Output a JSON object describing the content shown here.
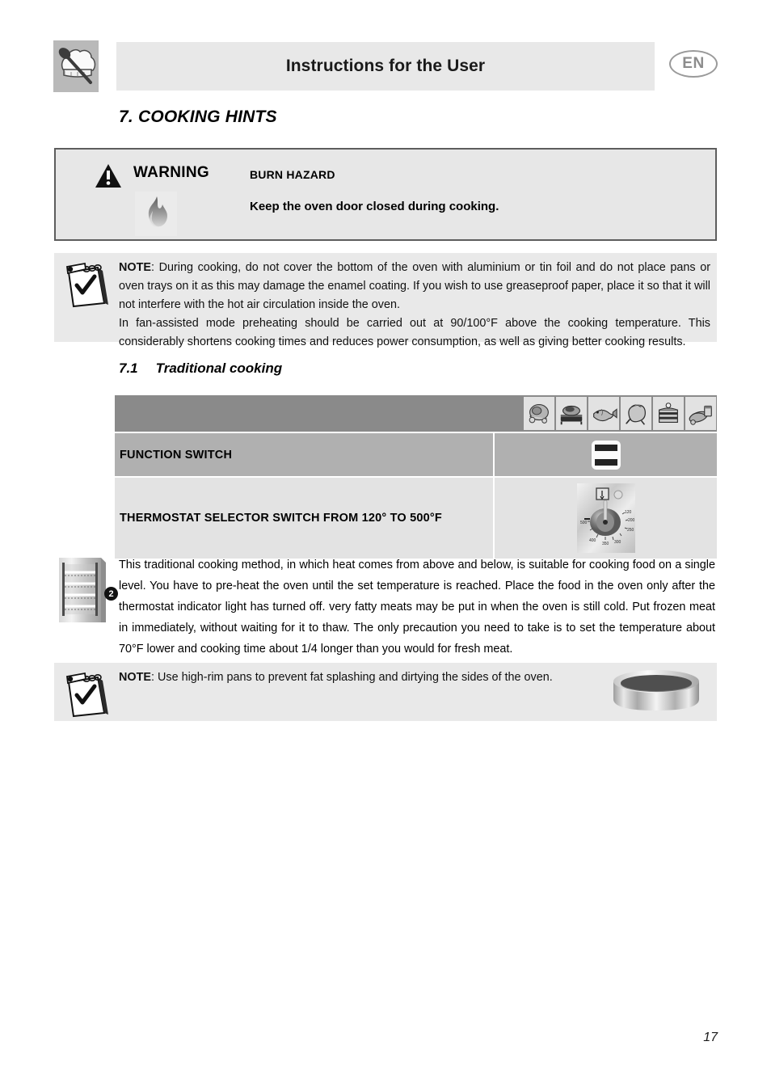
{
  "header": {
    "title": "Instructions for the User",
    "language_badge": "EN",
    "icon": "chef-hat-spoon-icon"
  },
  "section": {
    "number": "7.",
    "title": "7. COOKING HINTS"
  },
  "warning": {
    "label": "WARNING",
    "hazard_heading": "BURN HAZARD",
    "message": "Keep the oven door closed during cooking.",
    "triangle_icon": "warning-triangle-icon",
    "flame_icon": "flame-icon"
  },
  "note_general": {
    "label": "NOTE",
    "paragraph1": ": During cooking, do not cover the bottom of the oven with aluminium or tin foil and do not place pans or oven trays on it as this may damage the enamel coating. If you wish to use greaseproof paper, place it so that it will not interfere with the hot air circulation inside the oven.",
    "paragraph2": "In fan-assisted mode preheating should be carried out at 90/100°F above the cooking temperature. This considerably shortens cooking times and reduces power consumption, as well as giving better cooking results.",
    "icon": "notepad-checkmark-icon"
  },
  "subsection": {
    "number": "7.1",
    "title": "Traditional cooking"
  },
  "table": {
    "food_icons": [
      "roast-meat-icon",
      "grilled-meat-icon",
      "fish-icon",
      "poultry-icon",
      "cake-slice-icon",
      "pastry-bread-icon"
    ],
    "rows": [
      {
        "label": "FUNCTION SWITCH",
        "symbol": "top-bottom-heat-icon"
      },
      {
        "label": "THERMOSTAT SELECTOR SWITCH FROM 120° TO 500°F",
        "symbol": "thermostat-dial-icon"
      }
    ],
    "thermostat_dial_marks": [
      "120",
      "200",
      "250",
      "300",
      "350",
      "400",
      "500"
    ]
  },
  "description": {
    "shelf_level": "2",
    "oven_icon": "oven-shelf-levels-icon",
    "text": "This traditional cooking method, in which heat comes from above and below, is suitable for cooking food on a single level. You have to pre-heat the oven until the set temperature is reached. Place the food in the oven only after the thermostat indicator light has turned off. very fatty meats may be put in when the oven is still cold. Put frozen meat in immediately, without waiting for it to thaw. The only precaution you need to take is to set the temperature about 70°F lower and cooking time about 1/4 longer than you would for fresh meat."
  },
  "note_pans": {
    "label": "NOTE",
    "text": ": Use high-rim pans to prevent fat splashing and dirtying the sides of the oven.",
    "icon": "notepad-checkmark-icon",
    "pan_icon": "high-rim-pan-icon"
  },
  "footer": {
    "page_number": "17"
  },
  "colors": {
    "header_bar": "#e8e8e8",
    "note_bg": "#e9e9e9",
    "table_header": "#8a8a8a",
    "table_row_function": "#b0b0b0",
    "table_row_thermostat": "#e3e3e3",
    "warning_border": "#5d5d5d"
  }
}
